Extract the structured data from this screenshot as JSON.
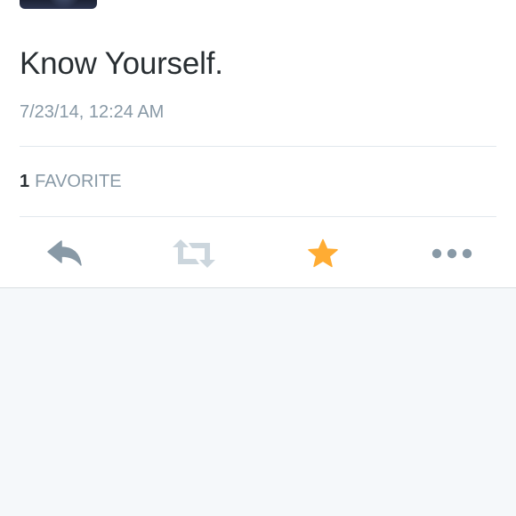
{
  "tweet": {
    "text": "Know Yourself.",
    "timestamp": "7/23/14, 12:24 AM"
  },
  "stats": {
    "favorites_count": "1",
    "favorites_label": "FAVORITE"
  },
  "actions": [
    {
      "name": "reply",
      "icon": "reply-icon",
      "color": "#8899a6"
    },
    {
      "name": "retweet",
      "icon": "retweet-icon",
      "color": "#ccd6dd",
      "disabled": true
    },
    {
      "name": "favorite",
      "icon": "star-icon",
      "color": "#ffac33",
      "active": true
    },
    {
      "name": "more",
      "icon": "more-icon",
      "color": "#8899a6"
    }
  ],
  "colors": {
    "text": "#292f33",
    "muted": "#8899a6",
    "favorite_active": "#ffac33",
    "divider": "#e1e8ed",
    "background": "#f5f8fa"
  }
}
